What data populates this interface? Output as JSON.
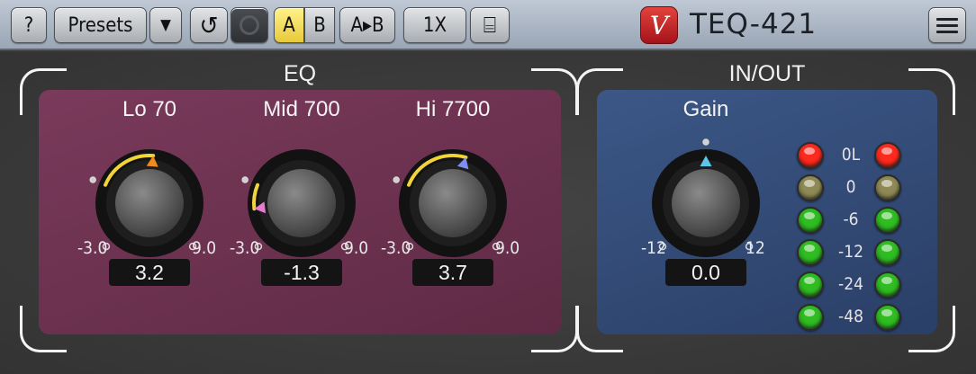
{
  "toolbar": {
    "help_label": "?",
    "presets_label": "Presets",
    "dropdown_glyph": "▼",
    "undo_glyph": "↺",
    "ab": {
      "a": "A",
      "b": "B",
      "copy": "A▸B",
      "active": "A"
    },
    "oversampling": "1X",
    "window_glyph": "⌸",
    "logo_glyph": "V",
    "title": "TEQ-421"
  },
  "eq": {
    "title": "EQ",
    "bands": [
      {
        "label": "Lo 70",
        "value": 3.2,
        "display": "3.2",
        "min_label": "-3.0",
        "max_label": "9.0",
        "min": -3.0,
        "max": 9.0,
        "pointer_color": "#f08a1e"
      },
      {
        "label": "Mid 700",
        "value": -1.3,
        "display": "-1.3",
        "min_label": "-3.0",
        "max_label": "9.0",
        "min": -3.0,
        "max": 9.0,
        "pointer_color": "#e77ad2"
      },
      {
        "label": "Hi 7700",
        "value": 3.7,
        "display": "3.7",
        "min_label": "-3.0",
        "max_label": "9.0",
        "min": -3.0,
        "max": 9.0,
        "pointer_color": "#7f8ef0"
      }
    ]
  },
  "io": {
    "title": "IN/OUT",
    "gain": {
      "label": "Gain",
      "value": 0.0,
      "display": "0.0",
      "min_label": "-12",
      "max_label": "12",
      "min": -12,
      "max": 12,
      "pointer_color": "#5cc7e8"
    },
    "meter": [
      {
        "label": "0L",
        "color": "red"
      },
      {
        "label": "0",
        "color": "yellow"
      },
      {
        "label": "-6",
        "color": "green"
      },
      {
        "label": "-12",
        "color": "green"
      },
      {
        "label": "-24",
        "color": "green"
      },
      {
        "label": "-48",
        "color": "green"
      }
    ]
  },
  "colors": {
    "arc": "#f2d43a",
    "led_red": "#ff2a1f",
    "led_yellow": "#8f8a55",
    "led_green": "#2fbd22"
  }
}
